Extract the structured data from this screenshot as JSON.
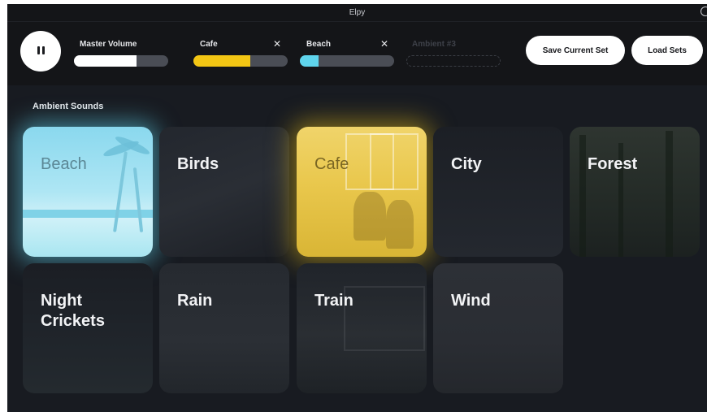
{
  "window": {
    "title": "Elpy"
  },
  "controls": {
    "pause_label": "Pause",
    "master": {
      "label": "Master Volume",
      "level": 0.66
    },
    "slots": [
      {
        "label": "Cafe",
        "close": "✕",
        "level": 0.6,
        "color": "#f3c614"
      },
      {
        "label": "Beach",
        "close": "✕",
        "level": 0.2,
        "color": "#5fd4ec"
      },
      {
        "label": "Ambient #3"
      }
    ],
    "save_label": "Save Current Set",
    "load_label": "Load Sets"
  },
  "section": {
    "title": "Ambient Sounds"
  },
  "tiles": [
    {
      "label": "Beach",
      "active": true,
      "glow": "#5fd4ec"
    },
    {
      "label": "Birds",
      "active": false
    },
    {
      "label": "Cafe",
      "active": true,
      "glow": "#f3c614"
    },
    {
      "label": "City",
      "active": false
    },
    {
      "label": "Forest",
      "active": false
    },
    {
      "label": "Night Crickets",
      "active": false
    },
    {
      "label": "Rain",
      "active": false
    },
    {
      "label": "Train",
      "active": false
    },
    {
      "label": "Wind",
      "active": false
    }
  ]
}
